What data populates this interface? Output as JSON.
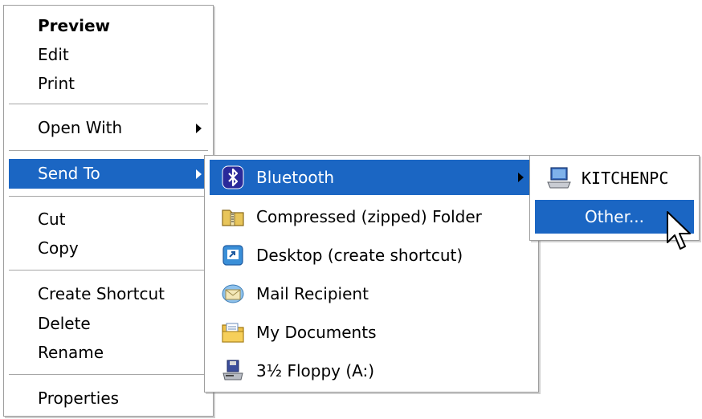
{
  "context_menu": {
    "items": [
      {
        "label": "Preview"
      },
      {
        "label": "Edit"
      },
      {
        "label": "Print"
      },
      {
        "label": "Open With"
      },
      {
        "label": "Send To"
      },
      {
        "label": "Cut"
      },
      {
        "label": "Copy"
      },
      {
        "label": "Create Shortcut"
      },
      {
        "label": "Delete"
      },
      {
        "label": "Rename"
      },
      {
        "label": "Properties"
      }
    ]
  },
  "send_to_menu": {
    "items": [
      {
        "label": "Bluetooth",
        "icon": "bluetooth-icon"
      },
      {
        "label": "Compressed (zipped) Folder",
        "icon": "zip-folder-icon"
      },
      {
        "label": "Desktop (create shortcut)",
        "icon": "desktop-shortcut-icon"
      },
      {
        "label": "Mail Recipient",
        "icon": "mail-recipient-icon"
      },
      {
        "label": "My Documents",
        "icon": "my-documents-icon"
      },
      {
        "label": "3½ Floppy (A:)",
        "icon": "floppy-drive-icon"
      }
    ]
  },
  "bluetooth_menu": {
    "items": [
      {
        "label": "KITCHENPC",
        "icon": "laptop-icon"
      },
      {
        "label": "Other..."
      }
    ]
  },
  "colors": {
    "highlight": "#1b66c3",
    "separator": "#a6a6a6"
  }
}
